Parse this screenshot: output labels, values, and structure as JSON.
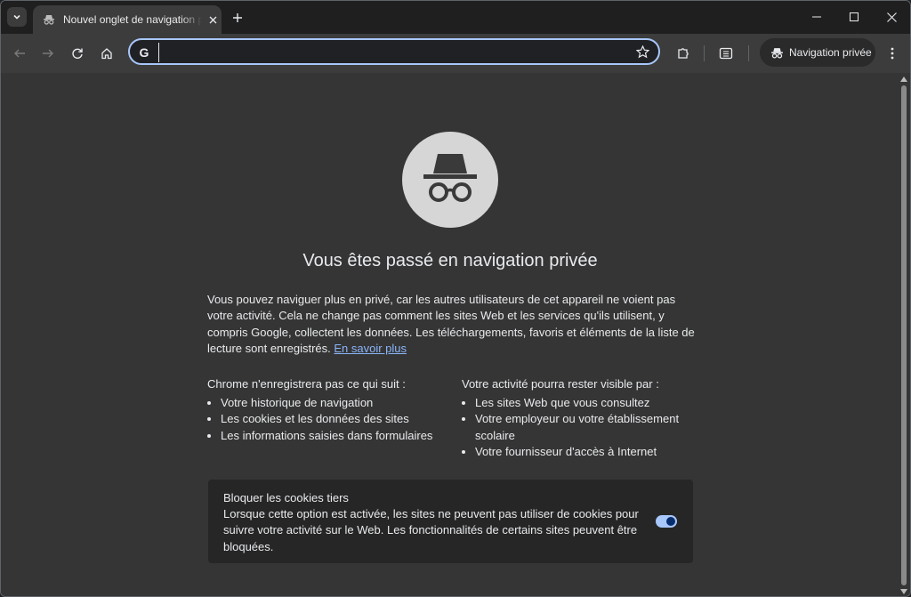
{
  "tabs": [
    {
      "title": "Nouvel onglet de navigation privée"
    }
  ],
  "toolbar": {
    "omnibox_value": "",
    "incognito_chip_label": "Navigation privée"
  },
  "content": {
    "title": "Vous êtes passé en navigation privée",
    "intro": "Vous pouvez naviguer plus en privé, car les autres utilisateurs de cet appareil ne voient pas votre activité. Cela ne change pas comment les sites Web et les services qu'ils utilisent, y compris Google, collectent les données. Les téléchargements, favoris et éléments de la liste de lecture sont enregistrés.",
    "learn_more": "En savoir plus",
    "not_saved": {
      "heading": "Chrome n'enregistrera pas ce qui suit :",
      "items": [
        "Votre historique de navigation",
        "Les cookies et les données des sites",
        "Les informations saisies dans formulaires"
      ]
    },
    "visible_to": {
      "heading": "Votre activité pourra rester visible par :",
      "items": [
        "Les sites Web que vous consultez",
        "Votre employeur ou votre établissement scolaire",
        "Votre fournisseur d'accès à Internet"
      ]
    },
    "cookie_card": {
      "title": "Bloquer les cookies tiers",
      "description": "Lorsque cette option est activée, les sites ne peuvent pas utiliser de cookies pour suivre votre activité sur le Web. Les fonctionnalités de certains sites peuvent être bloquées.",
      "toggle_on": true
    }
  },
  "colors": {
    "accent": "#a8c7fa",
    "link": "#8ab4f8",
    "background": "#353535"
  }
}
